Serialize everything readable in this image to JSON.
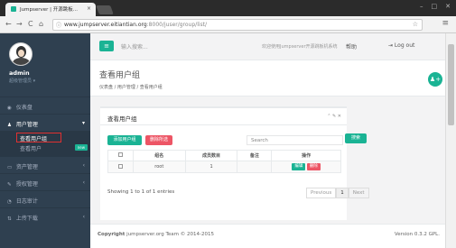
{
  "browser": {
    "tab_title": "Jumpserver | 开源跳板...",
    "tab_close": "×",
    "url": "www.jumpserver.eitiantian.org:8000/juser/group/list/",
    "url_host": "www.jumpserver.eitiantian.org",
    "url_rest": ":8000/juser/group/list/",
    "win_min": "–",
    "win_max": "□",
    "win_close": "✕",
    "back": "←",
    "forward": "→",
    "reload": "C",
    "home": "⌂",
    "star": "☆",
    "menu": "≡"
  },
  "profile": {
    "name": "admin",
    "role": "超级管理员 ▾"
  },
  "sidebar": {
    "items": [
      {
        "icon": "◉",
        "label": "仪表盘"
      },
      {
        "icon": "♟",
        "label": "用户管理",
        "arrow": "▾"
      },
      {
        "icon": "▭",
        "label": "资产管理",
        "arrow": "‹"
      },
      {
        "icon": "✎",
        "label": "授权管理",
        "arrow": "‹"
      },
      {
        "icon": "◔",
        "label": "日志审计"
      },
      {
        "icon": "⇅",
        "label": "上传下载",
        "arrow": "‹"
      }
    ],
    "sub_items": [
      {
        "label": "查看用户组"
      },
      {
        "label": "查看用户",
        "badge": "new"
      }
    ]
  },
  "topbar": {
    "menu_icon": "≡",
    "search_placeholder": "输入搜索...",
    "welcome": "欢迎使用Jumpserver开源跳板机系统",
    "help": "帮助",
    "logout": "⇥ Log out"
  },
  "heading": {
    "title": "查看用户组",
    "breadcrumb": "仪表盘 / 用户管理 / 查看用户组",
    "plus_icon": "♟+"
  },
  "panel": {
    "title": "查看用户组",
    "tools": "⌃ ✎ ✕",
    "add_button": "添加用户组",
    "delete_button": "删除所选",
    "search_placeholder": "Search",
    "search_button": "搜索",
    "columns": [
      "",
      "组名",
      "成员数目",
      "备注",
      "操作"
    ],
    "rows": [
      {
        "name": "root",
        "members": "1",
        "note": "",
        "edit": "编辑",
        "delete": "删除"
      }
    ],
    "entries": "Showing 1 to 1 of 1 entries",
    "pager": {
      "prev": "Previous",
      "page": "1",
      "next": "Next"
    }
  },
  "footer": {
    "copyright_bold": "Copyright",
    "copyright": "jumpserver.org Team © 2014-2015",
    "version": "Version 0.3.2 GPL."
  }
}
